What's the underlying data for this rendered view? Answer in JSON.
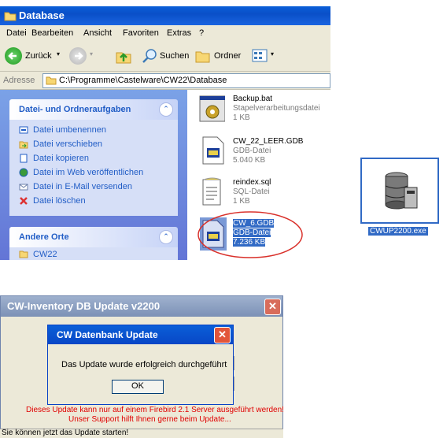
{
  "explorer": {
    "title": "Database",
    "menu": [
      "Datei",
      "Bearbeiten",
      "Ansicht",
      "Favoriten",
      "Extras",
      "?"
    ],
    "toolbar": {
      "back": "Zurück",
      "search": "Suchen",
      "folders": "Ordner"
    },
    "address": {
      "label": "Adresse",
      "path": "C:\\Programme\\Castelware\\CW22\\Database"
    },
    "tasks_panel": {
      "title": "Datei- und Ordneraufgaben",
      "items": [
        "Datei umbenennen",
        "Datei verschieben",
        "Datei kopieren",
        "Datei im Web veröffentlichen",
        "Datei in E-Mail versenden",
        "Datei löschen"
      ]
    },
    "other_places": {
      "title": "Andere Orte",
      "items": [
        "CW22"
      ]
    },
    "files": [
      {
        "name": "Backup.bat",
        "type": "Stapelverarbeitungsdatei",
        "size": "1 KB",
        "icon": "batch-file-icon"
      },
      {
        "name": "CW_22_LEER.GDB",
        "type": "GDB-Datei",
        "size": "5.040 KB",
        "icon": "gdb-file-icon"
      },
      {
        "name": "reindex.sql",
        "type": "SQL-Datei",
        "size": "1 KB",
        "icon": "sql-file-icon"
      },
      {
        "name": "CW_6.GDB",
        "type": "GDB-Datei",
        "size": "7.236 KB",
        "icon": "gdb-file-icon"
      }
    ]
  },
  "desktop_icon": {
    "label": "CWUP2200.exe",
    "icon": "database-app-icon"
  },
  "update_window": {
    "title": "CW-Inventory DB Update v2200",
    "warning_line1": "Dieses Update kann nur auf einem Firebird 2.1 Server ausgeführt werden!",
    "warning_line2": "Unser Support hilft Ihnen gerne beim Update...",
    "status": "Sie können jetzt das Update starten!"
  },
  "message_box": {
    "title": "CW Datenbank Update",
    "message": "Das Update wurde erfolgreich durchgeführt",
    "ok": "OK"
  },
  "colors": {
    "xp_blue": "#0a5fd8",
    "selection": "#316ac5",
    "highlight_circle": "#d9302a",
    "warning_text": "#e00000"
  }
}
